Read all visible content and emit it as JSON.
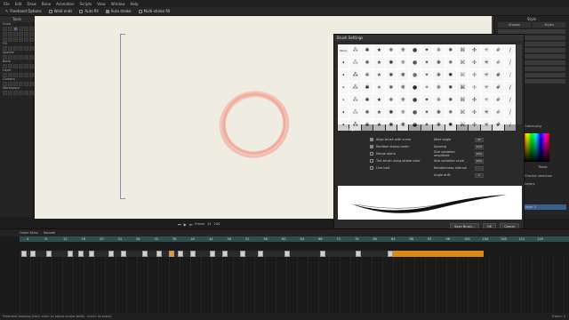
{
  "menu": [
    "File",
    "Edit",
    "Draw",
    "Bone",
    "Animation",
    "Scripts",
    "View",
    "Window",
    "Help"
  ],
  "toolbar": {
    "tool_name": "Freehand Options",
    "weld_label": "Weld ends",
    "autofill_label": "Auto fill",
    "autostroke_label": "Auto stroke",
    "multistroke_label": "Multi-stroke fill"
  },
  "left_panel": {
    "title": "Tools",
    "sections": [
      "Draw",
      "Fill",
      "Special",
      "Bone",
      "Layer",
      "Camera",
      "Workspace"
    ]
  },
  "right_panel": {
    "title": "Style",
    "tabs": [
      "Shapes",
      "Styles"
    ],
    "reset_label": "Reset",
    "checker_label": "Checker selection",
    "layers_label": "Layers",
    "layer_name": "Layer 1",
    "colors_label": "Colors.png"
  },
  "brush_window": {
    "title": "Brush Settings",
    "brush_name": "MC-Hairy3rk",
    "grid_first": "None",
    "options_left": [
      {
        "label": "Align brush with curve",
        "checked": true
      },
      {
        "label": "Random stamp order",
        "checked": true
      },
      {
        "label": "Merge alpha",
        "checked": false
      },
      {
        "label": "Tint brush using stroke color",
        "checked": false
      },
      {
        "label": "Line bolt",
        "checked": false
      }
    ],
    "options_right": [
      {
        "label": "Jitter angle",
        "value": "90"
      },
      {
        "label": "Spacing",
        "value": "10%"
      },
      {
        "label": "Size variation amplitude",
        "value": "20%"
      },
      {
        "label": "Size variation scale",
        "value": "20%"
      },
      {
        "label": "Randomness interval",
        "value": ""
      },
      {
        "label": "Angle drift",
        "value": "0"
      }
    ],
    "save_label": "Save Brush...",
    "ok_label": "OK",
    "cancel_label": "Cancel"
  },
  "canvas_bar": {
    "frame_label": "Frame",
    "frame_value": "41",
    "of_value": "240"
  },
  "timeline": {
    "onion_label": "Onion Skins",
    "interp_label": "Smooth",
    "ruler_numbers": [
      "4",
      "8",
      "12",
      "16",
      "20",
      "24",
      "28",
      "32",
      "36",
      "40",
      "44",
      "48",
      "52",
      "56",
      "60",
      "64",
      "68",
      "72",
      "76",
      "80",
      "84",
      "88",
      "92",
      "96",
      "100",
      "104",
      "108",
      "112",
      "116"
    ]
  },
  "status": {
    "text": "Freehand drawing (hold <alt> to adjust stroke width, <ctrl> to erase)",
    "right": "Frame: 0"
  },
  "colors": {
    "accent": "#d98a14",
    "stroke": "#f2a79a"
  }
}
